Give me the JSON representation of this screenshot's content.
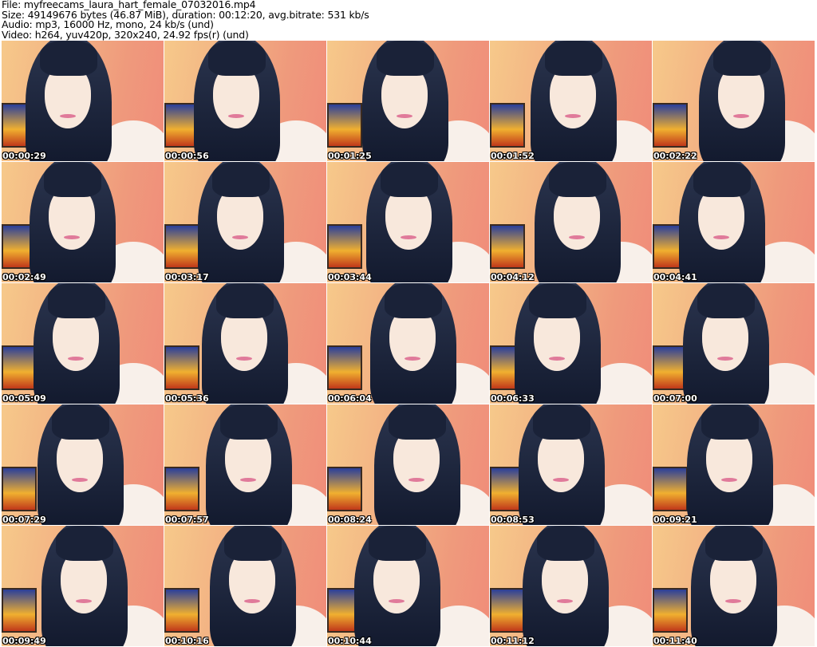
{
  "header": {
    "file": "File: myfreecams_laura_hart_female_07032016.mp4",
    "size": "Size: 49149676 bytes (46.87 MiB), duration: 00:12:20, avg.bitrate: 531 kb/s",
    "audio": "Audio: mp3, 16000 Hz, mono, 24 kb/s (und)",
    "video": "Video: h264, yuv420p, 320x240, 24.92 fps(r) (und)"
  },
  "thumbnails": [
    "00:00:29",
    "00:00:56",
    "00:01:25",
    "00:01:52",
    "00:02:22",
    "00:02:49",
    "00:03:17",
    "00:03:44",
    "00:04:12",
    "00:04:41",
    "00:05:09",
    "00:05:36",
    "00:06:04",
    "00:06:33",
    "00:07:00",
    "00:07:29",
    "00:07:57",
    "00:08:24",
    "00:08:53",
    "00:09:21",
    "00:09:49",
    "00:10:16",
    "00:10:44",
    "00:11:12",
    "00:11:40"
  ]
}
